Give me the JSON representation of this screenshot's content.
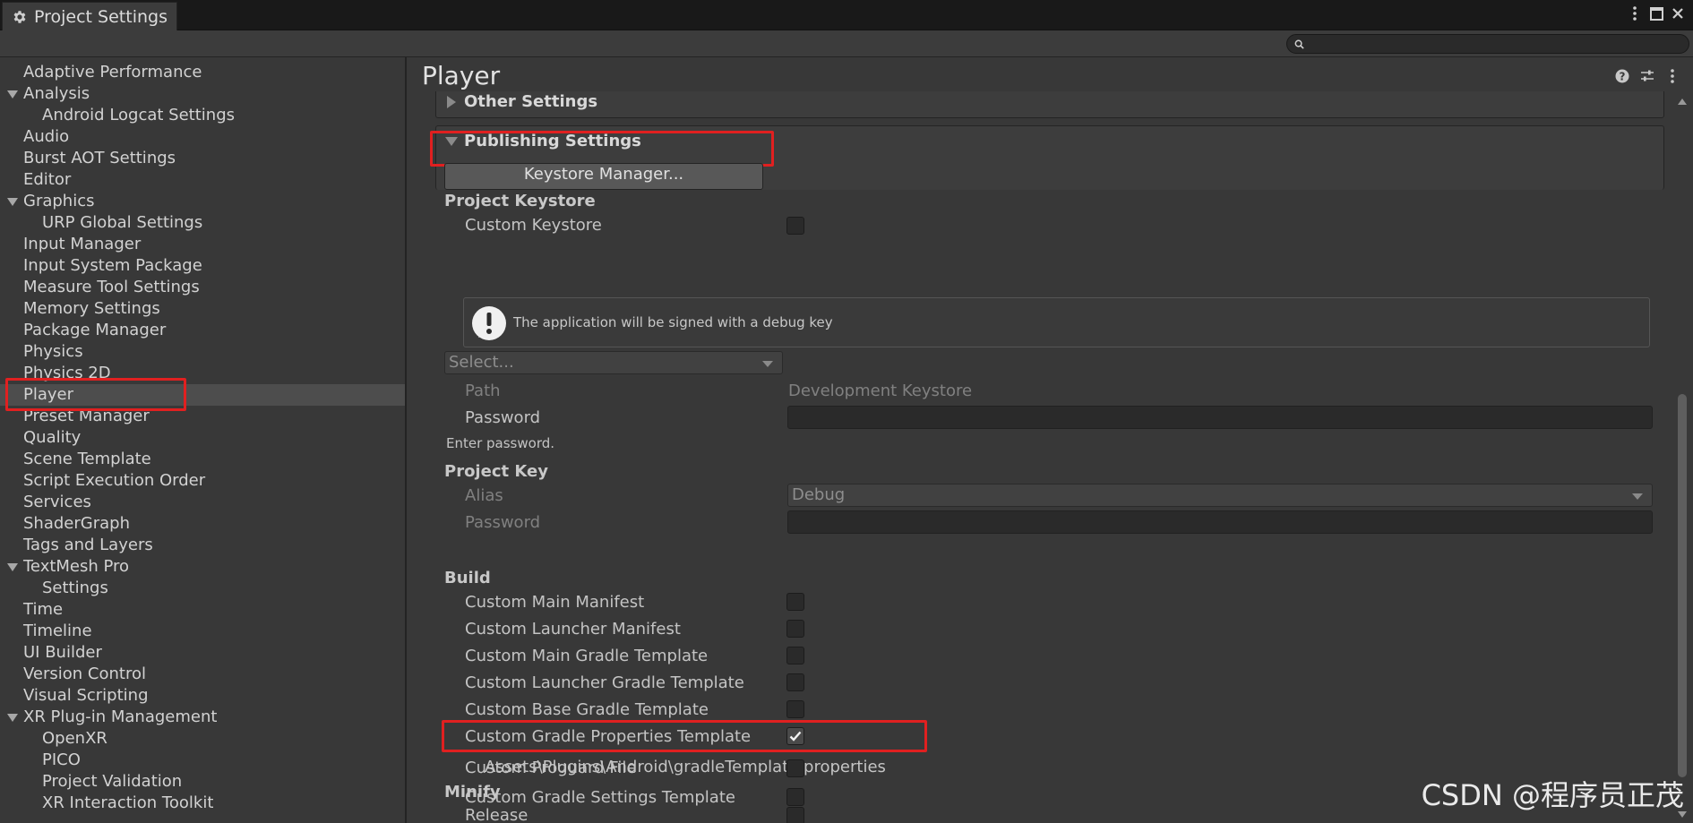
{
  "window": {
    "tab_title": "Project Settings",
    "tab_icon": "gear-icon",
    "controls": [
      "more-menu-icon",
      "maximize-icon",
      "close-icon"
    ]
  },
  "search": {
    "placeholder": "",
    "value": "",
    "icon": "search-icon"
  },
  "sidebar": {
    "selected": "Player",
    "items": [
      {
        "label": "Adaptive Performance",
        "level": 0,
        "expandable": false
      },
      {
        "label": "Analysis",
        "level": 0,
        "expandable": true
      },
      {
        "label": "Android Logcat Settings",
        "level": 1,
        "expandable": false
      },
      {
        "label": "Audio",
        "level": 0,
        "expandable": false
      },
      {
        "label": "Burst AOT Settings",
        "level": 0,
        "expandable": false
      },
      {
        "label": "Editor",
        "level": 0,
        "expandable": false
      },
      {
        "label": "Graphics",
        "level": 0,
        "expandable": true
      },
      {
        "label": "URP Global Settings",
        "level": 1,
        "expandable": false
      },
      {
        "label": "Input Manager",
        "level": 0,
        "expandable": false
      },
      {
        "label": "Input System Package",
        "level": 0,
        "expandable": false
      },
      {
        "label": "Measure Tool Settings",
        "level": 0,
        "expandable": false
      },
      {
        "label": "Memory Settings",
        "level": 0,
        "expandable": false
      },
      {
        "label": "Package Manager",
        "level": 0,
        "expandable": false
      },
      {
        "label": "Physics",
        "level": 0,
        "expandable": false
      },
      {
        "label": "Physics 2D",
        "level": 0,
        "expandable": false
      },
      {
        "label": "Player",
        "level": 0,
        "expandable": false
      },
      {
        "label": "Preset Manager",
        "level": 0,
        "expandable": false
      },
      {
        "label": "Quality",
        "level": 0,
        "expandable": false
      },
      {
        "label": "Scene Template",
        "level": 0,
        "expandable": false
      },
      {
        "label": "Script Execution Order",
        "level": 0,
        "expandable": false
      },
      {
        "label": "Services",
        "level": 0,
        "expandable": false
      },
      {
        "label": "ShaderGraph",
        "level": 0,
        "expandable": false
      },
      {
        "label": "Tags and Layers",
        "level": 0,
        "expandable": false
      },
      {
        "label": "TextMesh Pro",
        "level": 0,
        "expandable": true
      },
      {
        "label": "Settings",
        "level": 1,
        "expandable": false
      },
      {
        "label": "Time",
        "level": 0,
        "expandable": false
      },
      {
        "label": "Timeline",
        "level": 0,
        "expandable": false
      },
      {
        "label": "UI Builder",
        "level": 0,
        "expandable": false
      },
      {
        "label": "Version Control",
        "level": 0,
        "expandable": false
      },
      {
        "label": "Visual Scripting",
        "level": 0,
        "expandable": false
      },
      {
        "label": "XR Plug-in Management",
        "level": 0,
        "expandable": true
      },
      {
        "label": "OpenXR",
        "level": 1,
        "expandable": false
      },
      {
        "label": "PICO",
        "level": 1,
        "expandable": false
      },
      {
        "label": "Project Validation",
        "level": 1,
        "expandable": false
      },
      {
        "label": "XR Interaction Toolkit",
        "level": 1,
        "expandable": false
      }
    ]
  },
  "main": {
    "title": "Player",
    "header_icons": [
      "help-icon",
      "presets-icon",
      "more-menu-icon"
    ],
    "other_settings": "Other Settings",
    "publishing_settings": "Publishing Settings",
    "keystore_manager": "Keystore Manager...",
    "project_keystore": {
      "header": "Project Keystore",
      "custom_keystore_label": "Custom Keystore",
      "custom_keystore_checked": false,
      "help_message": "The application will be signed with a debug key",
      "select_value": "Select...",
      "path_label": "Path",
      "path_value": "Development Keystore",
      "password_label": "Password",
      "password_value": "",
      "password_hint": "Enter password."
    },
    "project_key": {
      "header": "Project Key",
      "alias_label": "Alias",
      "alias_value": "Debug",
      "password_label": "Password",
      "password_value": ""
    },
    "build": {
      "header": "Build",
      "custom_main_manifest": "Custom Main Manifest",
      "custom_launcher_manifest": "Custom Launcher Manifest",
      "custom_main_gradle": "Custom Main Gradle Template",
      "custom_launcher_gradle": "Custom Launcher Gradle Template",
      "custom_base_gradle": "Custom Base Gradle Template",
      "custom_gradle_properties": "Custom Gradle Properties Template",
      "custom_gradle_properties_checked": true,
      "gradle_properties_path": "Assets\\Plugins\\Android\\gradleTemplate.properties",
      "custom_gradle_settings": "Custom Gradle Settings Template",
      "custom_proguard": "Custom Proguard File"
    },
    "minify": {
      "header": "Minify",
      "release_label": "Release"
    }
  },
  "watermark": "CSDN @程序员正茂",
  "colors": {
    "background": "#383838",
    "titlebar": "#191919",
    "selected_row": "#4d4d4d",
    "highlight_box": "#e02020"
  }
}
